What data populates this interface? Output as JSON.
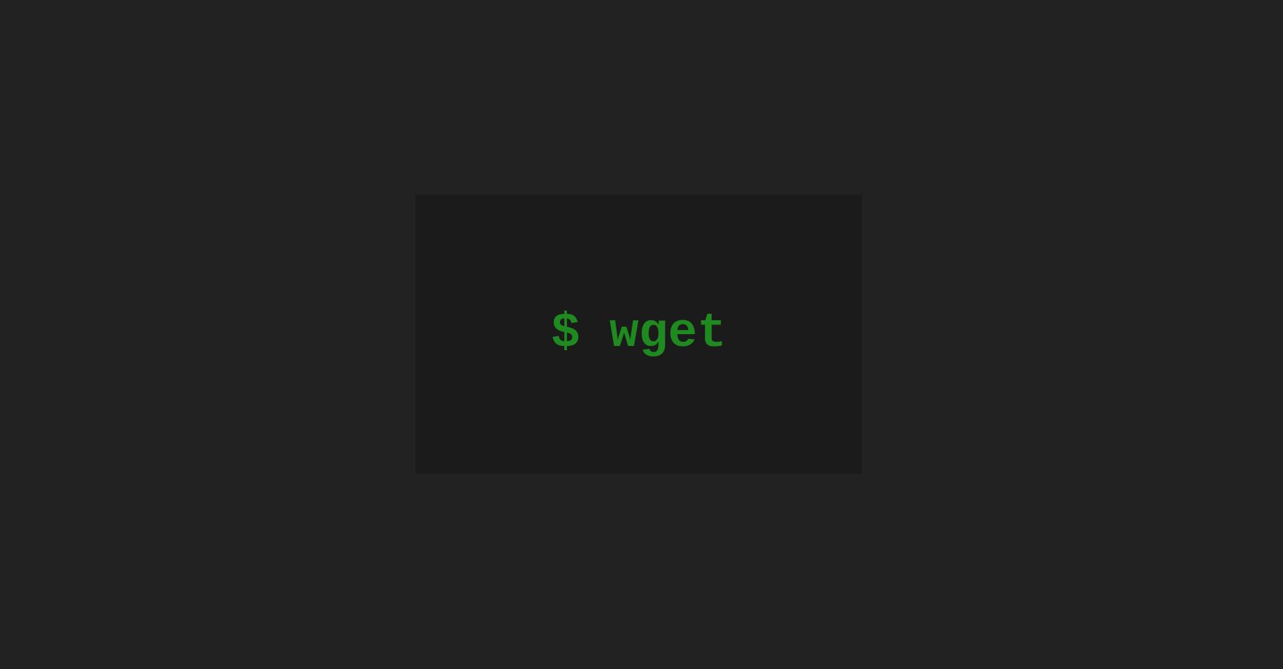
{
  "terminal": {
    "prompt": "$",
    "command": "wget"
  },
  "colors": {
    "background": "#222222",
    "card": "#1b1b1b",
    "text": "#1f8a1f"
  }
}
